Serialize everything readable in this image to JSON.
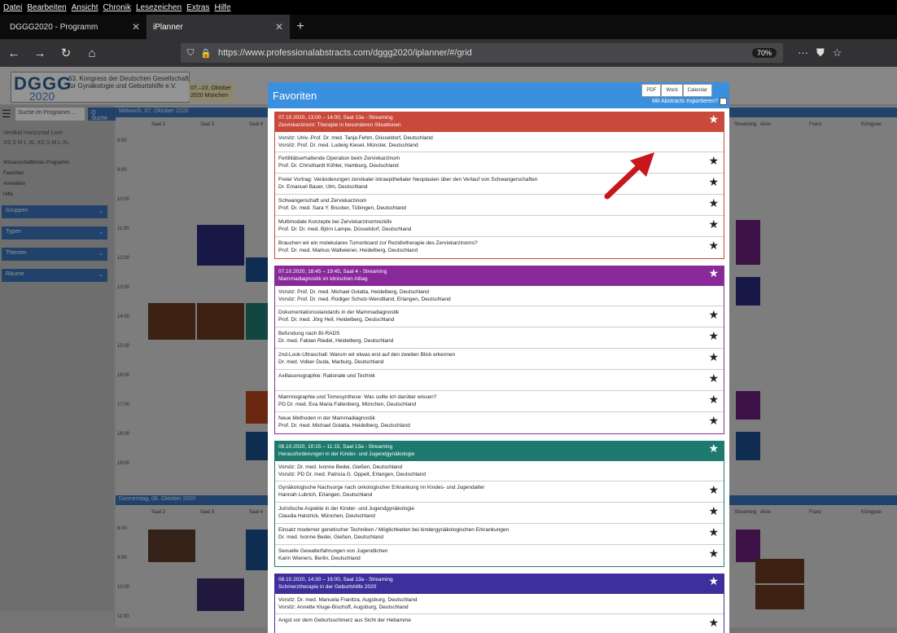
{
  "browser": {
    "menu": [
      "Datei",
      "Bearbeiten",
      "Ansicht",
      "Chronik",
      "Lesezeichen",
      "Extras",
      "Hilfe"
    ],
    "tabs": [
      {
        "label": "DGGG2020 - Programm"
      },
      {
        "label": "iPlanner"
      }
    ],
    "url": "https://www.professionalabstracts.com/dggg2020/iplanner/#/grid",
    "zoom": "70%"
  },
  "site": {
    "logo_big": "DGGG",
    "logo_year": "2020",
    "logo_sub": "63. Kongress der Deutschen Gesellschaft für Gynäkologie und Geburtshilfe e.V.",
    "date_badge": "07.–10. Oktober 2020 München",
    "search_placeholder": "Suche im Programm ...",
    "search_button": "Q Suche",
    "view_row": "Vertikal   Horizontal   Liste",
    "size_row": "XS S M L XL    XS S M L XL",
    "links": [
      "Wissenschaftliches Programm",
      "Favoriten",
      "Anmelden",
      "Hilfe"
    ],
    "dropdowns": [
      "Gruppen",
      "Typen",
      "Themen",
      "Räume"
    ],
    "day1": "Mittwoch, 07. Oktober 2020",
    "day2": "Donnerstag, 08. Oktober 2020",
    "cols": [
      "Saal 2",
      "Saal 3",
      "Saal 4"
    ],
    "cols_right": [
      "Streaming",
      "Alois",
      "Franz",
      "Königsee"
    ],
    "times": [
      "8:00",
      "9:00",
      "10:00",
      "11:00",
      "12:00",
      "13:00",
      "14:00",
      "15:00",
      "16:00",
      "17:00",
      "18:00",
      "19:00"
    ],
    "times2": [
      "8:00",
      "9:00",
      "10:00",
      "11:00",
      "12:00"
    ]
  },
  "modal": {
    "title": "Favoriten",
    "buttons": [
      "PDF",
      "Word",
      "Calendar"
    ],
    "export_label": "Mit Abstracts exportieren?",
    "colors": {
      "s1": "#c94a3c",
      "s2": "#8a2a9a",
      "s3": "#1e7a6e",
      "s4": "#3f2f9c",
      "header": "#3a8fde"
    },
    "sessions": [
      {
        "head1": "07.10.2020, 13:00 – 14:00, Saal 13a - Streaming",
        "head2": "Zervixkarzinom: Therapie in besonderen Situationen",
        "vorsitz": [
          "Vorsitz: Univ.-Prof. Dr. med. Tanja Fehm, Düsseldorf, Deutschland",
          "Vorsitz: Prof. Dr. med. Ludwig Kiesel, Münster, Deutschland"
        ],
        "talks": [
          {
            "t": "Fertilitätserhaltende Operation beim Zervixkarzinom",
            "a": "Prof. Dr. Christhardt Köhler, Hamburg, Deutschland"
          },
          {
            "t": "Freier Vortrag: Veränderungen zervikaler intraepithelialer Neoplasien über den Verlauf von Schwangerschaften",
            "a": "Dr. Emanuel Bauer, Ulm, Deutschland"
          },
          {
            "t": "Schwangerschaft und Zervixkarzinom",
            "a": "Prof. Dr. med. Sara Y. Brucker, Tübingen, Deutschland"
          },
          {
            "t": "Multimodale Konzepte bei Zervixkarzinomrezidiv",
            "a": "Prof. Dr. Dr. med. Björn Lampe, Düsseldorf, Deutschland"
          },
          {
            "t": "Brauchen wir ein molekulares Tumorboard zur Rezidivtherapie des Zervixkarzinoms?",
            "a": "Prof. Dr. med. Markus Wallwiener, Heidelberg, Deutschland"
          }
        ]
      },
      {
        "head1": "07.10.2020, 18:45 – 19:45, Saal 4 - Streaming",
        "head2": "Mammadiagnostik im klinischen Alltag",
        "vorsitz": [
          "Vorsitz: Prof. Dr. med. Michael Golatta, Heidelberg, Deutschland",
          "Vorsitz: Prof. Dr. med. Rüdiger Schulz-Wendtland, Erlangen, Deutschland"
        ],
        "talks": [
          {
            "t": "Dokumentationsstandards in der Mammadiagnostik",
            "a": "Prof. Dr. med. Jörg Heil, Heidelberg, Deutschland"
          },
          {
            "t": "Befundung nach BI-RADS",
            "a": "Dr. med. Fabian Riedel, Heidelberg, Deutschland"
          },
          {
            "t": "2nd-Look-Ultraschall: Warum wir etwas erst auf den zweiten Blick erkennen",
            "a": "Dr. med. Volker Duda, Marburg, Deutschland"
          },
          {
            "t": "Axillasonographie: Rationale und Technik",
            "a": ""
          },
          {
            "t": "Mammographie und Tomosynthese: Was sollte ich darüber wissen?",
            "a": "PD Dr. med. Eva Maria Fallenberg, München, Deutschland"
          },
          {
            "t": "Neue Methoden in der Mammadiagnostik",
            "a": "Prof. Dr. med. Michael Golatta, Heidelberg, Deutschland"
          }
        ]
      },
      {
        "head1": "08.10.2020, 10:15 – 11:15, Saal 13a - Streaming",
        "head2": "Herausforderungen in der Kinder- und Jugendgynäkologie",
        "vorsitz": [
          "Vorsitz: Dr. med. Ivonne Bedei, Gießen, Deutschland",
          "Vorsitz: PD Dr. med. Patricia G. Oppelt, Erlangen, Deutschland"
        ],
        "talks": [
          {
            "t": "Gynäkologische Nachsorge nach onkologischer Erkrankung im Kindes- und Jugendalter",
            "a": "Hannah Lubrich, Erlangen, Deutschland"
          },
          {
            "t": "Juristische Aspekte in der Kinder- und Jugendgynäkologie",
            "a": "Claudia Halstrick, München, Deutschland"
          },
          {
            "t": "Einsatz moderner genetischer Techniken / Möglichkeiten bei kindergynäkologischen Erkrankungen",
            "a": "Dr. med. Ivonne Bedei, Gießen, Deutschland"
          },
          {
            "t": "Sexuelle Gewalterfahrungen von Jugendlichen",
            "a": "Karin Wieners, Berlin, Deutschland"
          }
        ]
      },
      {
        "head1": "08.10.2020, 14:30 – 16:00, Saal 13a - Streaming",
        "head2": "Schmerztherapie in der Geburtshilfe 2020",
        "vorsitz": [
          "Vorsitz: Dr. med. Manuela Franitza, Augsburg, Deutschland",
          "Vorsitz: Annette Kluge-Bischoff, Augsburg, Deutschland"
        ],
        "talks": [
          {
            "t": "Angst vor dem Geburtsschmerz aus Sicht der Hebamme",
            "a": ""
          }
        ]
      }
    ]
  }
}
